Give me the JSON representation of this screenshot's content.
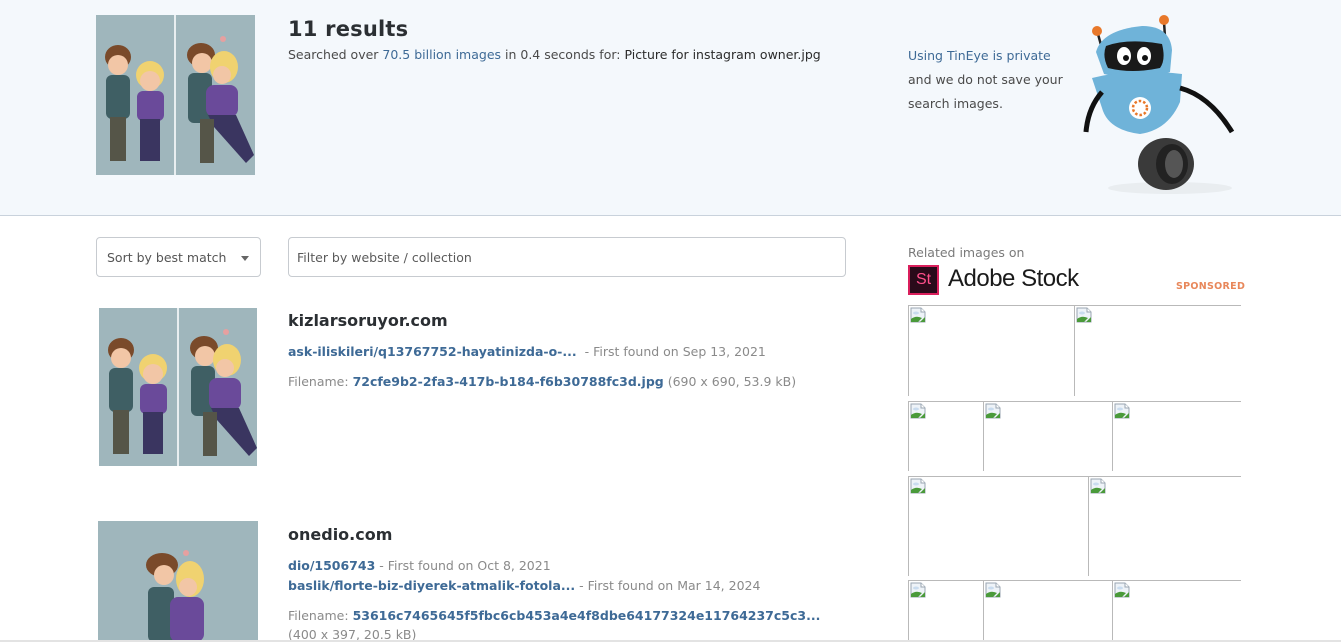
{
  "header": {
    "results_count": "11 results",
    "summary_prefix": "Searched over ",
    "summary_link": "70.5 billion images",
    "summary_middle": " in 0.4 seconds for: ",
    "query_filename": "Picture for instagram owner.jpg",
    "privacy_link": "Using TinEye is private",
    "privacy_line2": "and we do not save your",
    "privacy_line3": "search images."
  },
  "controls": {
    "sort_label": "Sort by best match",
    "filter_placeholder": "Filter by website / collection"
  },
  "results": [
    {
      "domain": "kizlarsoruyor.com",
      "matches": [
        {
          "path": "ask-iliskileri/q13767752-hayatinizda-o-...",
          "found": " - First found on Sep 13, 2021"
        }
      ],
      "filename_label": "Filename: ",
      "filename": "72cfe9b2-2fa3-417b-b184-f6b30788fc3d.jpg",
      "meta": " (690 x 690, 53.9 kB)"
    },
    {
      "domain": "onedio.com",
      "matches": [
        {
          "path": "dio/1506743",
          "found": " - First found on Oct 8, 2021"
        },
        {
          "path": "baslik/florte-biz-diyerek-atmalik-fotola...",
          "found": " - First found on Mar 14, 2024"
        }
      ],
      "filename_label": "Filename: ",
      "filename": "53616c7465645f5fbc6cb453a4e4f8dbe64177324e11764237c5c3...",
      "meta": "(400 x 397, 20.5 kB)"
    }
  ],
  "sidebar": {
    "related_label": "Related images on",
    "adobe_logo_text": "St",
    "adobe_brand": "Adobe Stock",
    "sponsored_label": "SPONSORED",
    "tile_count": 12
  },
  "colors": {
    "link": "#3e6a96",
    "hero_bg": "#f4f8fc",
    "sponsored": "#e8875a",
    "adobe_pink": "#da1f5c"
  }
}
